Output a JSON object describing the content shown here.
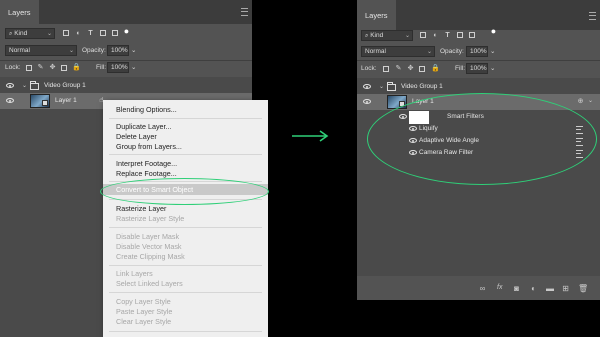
{
  "left_panel": {
    "tab_label": "Layers",
    "kind_label": "Kind",
    "blend_mode": "Normal",
    "opacity_label": "Opacity:",
    "opacity_value": "100%",
    "lock_label": "Lock:",
    "fill_label": "Fill:",
    "fill_value": "100%",
    "group_name": "Video Group 1",
    "layer_name": "Layer 1"
  },
  "context_menu": {
    "items": [
      {
        "label": "Blending Options...",
        "enabled": true
      },
      {
        "label": "Duplicate Layer...",
        "enabled": true
      },
      {
        "label": "Delete Layer",
        "enabled": true
      },
      {
        "label": "Group from Layers...",
        "enabled": true
      },
      {
        "label": "Interpret Footage...",
        "enabled": true
      },
      {
        "label": "Replace Footage...",
        "enabled": true
      },
      {
        "label": "Convert to Smart Object",
        "enabled": true,
        "highlighted": true
      },
      {
        "label": "Rasterize Layer",
        "enabled": true
      },
      {
        "label": "Rasterize Layer Style",
        "enabled": false
      },
      {
        "label": "Disable Layer Mask",
        "enabled": false
      },
      {
        "label": "Disable Vector Mask",
        "enabled": false
      },
      {
        "label": "Create Clipping Mask",
        "enabled": false
      },
      {
        "label": "Link Layers",
        "enabled": false
      },
      {
        "label": "Select Linked Layers",
        "enabled": false
      },
      {
        "label": "Copy Layer Style",
        "enabled": false
      },
      {
        "label": "Paste Layer Style",
        "enabled": false
      },
      {
        "label": "Clear Layer Style",
        "enabled": false
      }
    ]
  },
  "arrow_color": "#2fcf78",
  "right_panel": {
    "tab_label": "Layers",
    "kind_label": "Kind",
    "blend_mode": "Normal",
    "opacity_label": "Opacity:",
    "opacity_value": "100%",
    "lock_label": "Lock:",
    "fill_label": "Fill:",
    "fill_value": "100%",
    "group_name": "Video Group 1",
    "layer_name": "Layer 1",
    "smart_filters_label": "Smart Filters",
    "filters": [
      "Liquify",
      "Adaptive Wide Angle",
      "Camera Raw Filter"
    ],
    "fx_label": "fx"
  },
  "colors": {
    "panel": "#535353",
    "highlight_oval": "#2fcf78",
    "menu_bg": "#efefef"
  }
}
